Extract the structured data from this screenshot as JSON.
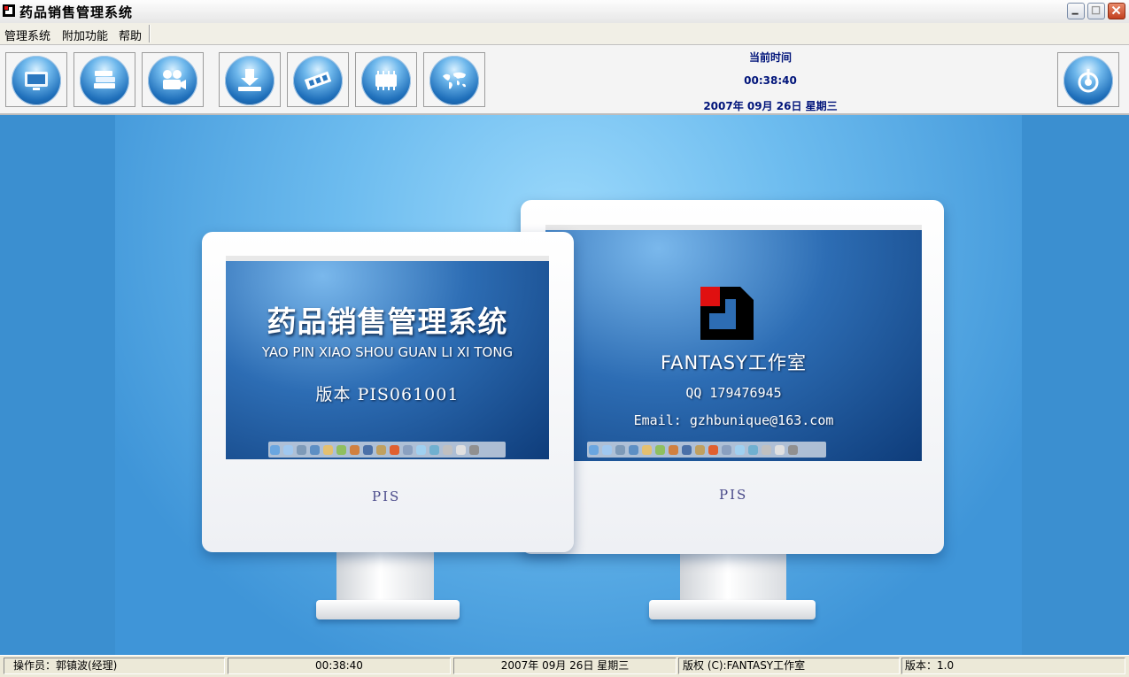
{
  "window": {
    "title": "药品销售管理系统",
    "controls": [
      "minimize",
      "maximize",
      "close"
    ]
  },
  "menu": {
    "items": [
      "管理系统",
      "附加功能",
      "帮助"
    ]
  },
  "toolbar": {
    "buttons": [
      {
        "icon": "monitor-icon"
      },
      {
        "icon": "books-icon"
      },
      {
        "icon": "film-projector-icon"
      },
      {
        "icon": "download-icon"
      },
      {
        "icon": "film-strip-icon"
      },
      {
        "icon": "chip-icon"
      },
      {
        "icon": "world-map-icon"
      },
      {
        "icon": "exit-icon"
      }
    ],
    "time_label": "当前时间",
    "time": "00:38:40",
    "date": "2007年 09月 26日 星期三"
  },
  "splash": {
    "left_screen": {
      "title": "药品销售管理系统",
      "subtitle": "YAO PIN XIAO SHOU GUAN LI XI TONG",
      "version": "版本 PIS061001",
      "brand": "PIS"
    },
    "right_screen": {
      "studio": "FANTASY工作室",
      "qq": "QQ 179476945",
      "email": "Email: gzhbunique@163.com",
      "brand": "PIS"
    }
  },
  "status": {
    "operator": "操作员：郭镇波(经理)",
    "time": "00:38:40",
    "date": "2007年 09月 26日 星期三",
    "copyright": "版权 (C):FANTASY工作室",
    "version": "版本：1.0"
  },
  "colors": {
    "time_text": "#00147a",
    "background_blue": "#3b8fd0",
    "logo_red": "#e01010"
  }
}
